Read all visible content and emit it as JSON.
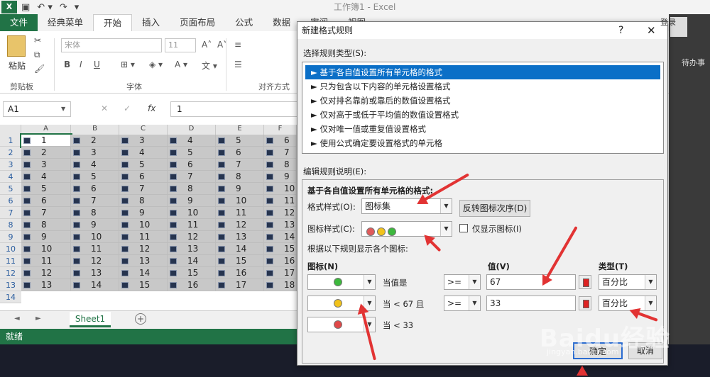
{
  "app": {
    "title": "工作簿1 - Excel",
    "logo": "X"
  },
  "tabs": [
    "文件",
    "经典菜单",
    "开始",
    "插入",
    "页面布局",
    "公式",
    "数据",
    "审阅",
    "视图"
  ],
  "ribbon": {
    "paste": "粘贴",
    "clipboard": "剪贴板",
    "font_group": "字体",
    "align_group": "对齐方式",
    "font_name": "宋体",
    "font_size": "11",
    "bold": "B",
    "italic": "I",
    "underline": "U",
    "login": "登录"
  },
  "formula": {
    "namebox": "A1",
    "value": "1",
    "fx": "fx"
  },
  "sheet": {
    "columns": [
      "A",
      "B",
      "C",
      "D",
      "E",
      "F"
    ],
    "rows": [
      [
        1,
        2,
        3,
        4,
        5,
        6
      ],
      [
        2,
        3,
        4,
        5,
        6,
        7
      ],
      [
        3,
        4,
        5,
        6,
        7,
        8
      ],
      [
        4,
        5,
        6,
        7,
        8,
        9
      ],
      [
        5,
        6,
        7,
        8,
        9,
        10
      ],
      [
        6,
        7,
        8,
        9,
        10,
        11
      ],
      [
        7,
        8,
        9,
        10,
        11,
        12
      ],
      [
        8,
        9,
        10,
        11,
        12,
        13
      ],
      [
        9,
        10,
        11,
        12,
        13,
        14
      ],
      [
        10,
        11,
        12,
        13,
        14,
        15
      ],
      [
        11,
        12,
        13,
        14,
        15,
        16
      ],
      [
        12,
        13,
        14,
        15,
        16,
        17
      ],
      [
        13,
        14,
        15,
        16,
        17,
        18
      ]
    ],
    "row_numbers": [
      "1",
      "2",
      "3",
      "4",
      "5",
      "6",
      "7",
      "8",
      "9",
      "10",
      "11",
      "12",
      "13",
      "14"
    ],
    "tab": "Sheet1",
    "status": "就绪"
  },
  "side": {
    "text": "待办事"
  },
  "dialog": {
    "title": "新建格式规则",
    "help": "?",
    "close": "✕",
    "select_type_label": "选择规则类型(S):",
    "rules": [
      "► 基于各自值设置所有单元格的格式",
      "► 只为包含以下内容的单元格设置格式",
      "► 仅对排名靠前或靠后的数值设置格式",
      "► 仅对高于或低于平均值的数值设置格式",
      "► 仅对唯一值或重复值设置格式",
      "► 使用公式确定要设置格式的单元格"
    ],
    "edit_label": "编辑规则说明(E):",
    "edit_heading": "基于各自值设置所有单元格的格式:",
    "format_style_label": "格式样式(O):",
    "format_style_value": "图标集",
    "reverse_button": "反转图标次序(D)",
    "icon_style_label": "图标样式(C):",
    "icon_only_label": "仅显示图标(I)",
    "rule_hint": "根据以下规则显示各个图标:",
    "col_icon": "图标(N)",
    "col_value": "值(V)",
    "col_type": "类型(T)",
    "icon_rules": [
      {
        "color": "#3db83d",
        "cond": "当值是",
        "op": ">=",
        "value": "67",
        "type": "百分比"
      },
      {
        "color": "#f1c21b",
        "cond": "当 < 67 且",
        "op": ">=",
        "value": "33",
        "type": "百分比"
      },
      {
        "color": "#e04848",
        "cond": "当 < 33"
      }
    ],
    "ok": "确定",
    "cancel": "取消"
  },
  "watermark": {
    "main": "Baidu经验",
    "sub": "jingyan.baidu.com"
  }
}
